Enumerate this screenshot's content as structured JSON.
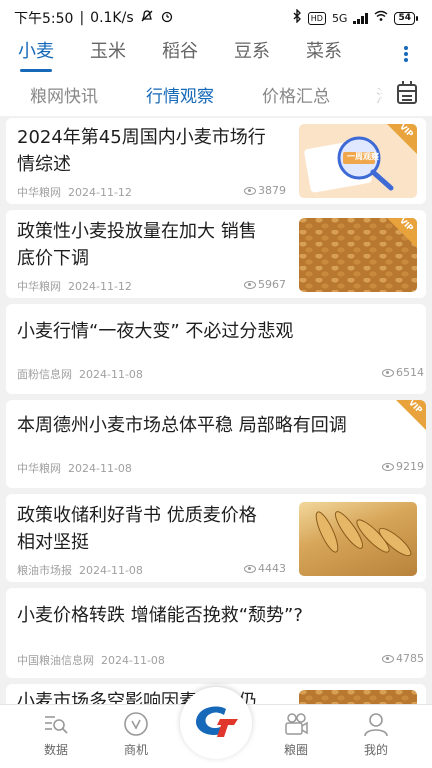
{
  "status_bar": {
    "time": "下午5:50",
    "speed": "0.1K/s",
    "network": "5G",
    "battery": "54"
  },
  "categories": [
    "小麦",
    "玉米",
    "稻谷",
    "豆系",
    "菜系"
  ],
  "sub_tabs": [
    "粮网快讯",
    "行情观察",
    "价格汇总",
    "港"
  ],
  "articles": [
    {
      "title_line1": "2024年第45周国内小麦市场行",
      "title_line2": "情综述",
      "source": "中华粮网",
      "date": "2024-11-12",
      "views": "3879",
      "thumb_text": "一周观察",
      "vip": "VIP"
    },
    {
      "title_line1": "政策性小麦投放量在加大 销售",
      "title_line2": "底价下调",
      "source": "中华粮网",
      "date": "2024-11-12",
      "views": "5967",
      "vip": "VIP"
    },
    {
      "title_line1": "小麦行情“一夜大变” 不必过分悲观",
      "title_line2": "",
      "source": "面粉信息网",
      "date": "2024-11-08",
      "views": "6514"
    },
    {
      "title_line1": "本周德州小麦市场总体平稳 局部略有回调",
      "title_line2": "",
      "source": "中华粮网",
      "date": "2024-11-08",
      "views": "9219",
      "vip": "VIP"
    },
    {
      "title_line1": "政策收储利好背书 优质麦价格",
      "title_line2": "相对坚挺",
      "source": "粮油市场报",
      "date": "2024-11-08",
      "views": "4443"
    },
    {
      "title_line1": "小麦价格转跌 增储能否挽救“颓势”?",
      "title_line2": "",
      "source": "中国粮油信息网",
      "date": "2024-11-08",
      "views": "4785"
    },
    {
      "title_line1": "小麦市场多空影响因素交织 仍",
      "title_line2": "",
      "source": "",
      "date": "",
      "views": ""
    }
  ],
  "bottom_nav": {
    "data": "数据",
    "business": "商机",
    "circle": "粮圈",
    "mine": "我的"
  },
  "colors": {
    "accent": "#1669b8",
    "vip": "#e8a33d"
  },
  "icons": [
    "bluetooth-icon",
    "mute-icon",
    "alarm-icon",
    "wifi-icon",
    "calendar-icon",
    "eye-icon",
    "data-icon",
    "business-icon",
    "app-logo-icon",
    "circle-icon",
    "user-icon"
  ]
}
